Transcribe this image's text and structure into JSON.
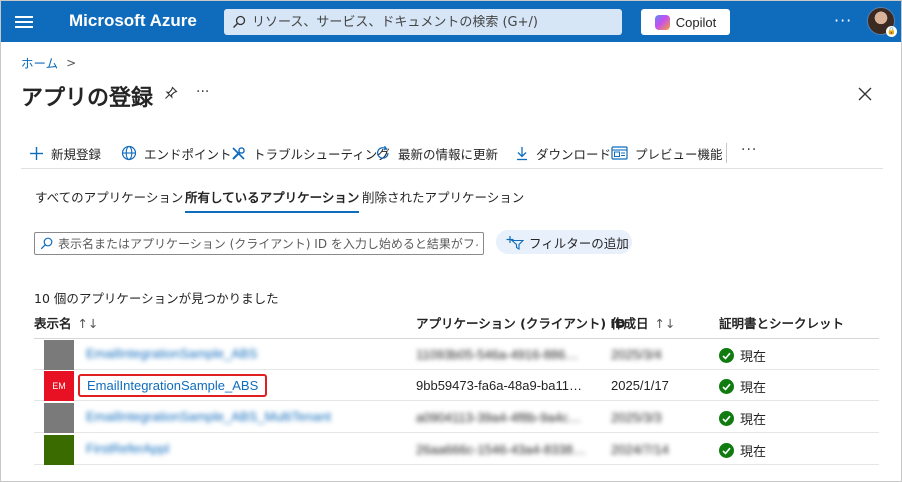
{
  "topbar": {
    "brand": "Microsoft Azure",
    "search_placeholder": "リソース、サービス、ドキュメントの検索 (G+/)",
    "copilot_label": "Copilot",
    "more_label": "···"
  },
  "breadcrumb": {
    "home": "ホーム",
    "separator": ">"
  },
  "page": {
    "title": "アプリの登録",
    "more_label": "···"
  },
  "toolbar": {
    "new_registration": "新規登録",
    "endpoints": "エンドポイント",
    "troubleshooting": "トラブルシューティング",
    "refresh": "最新の情報に更新",
    "download": "ダウンロード",
    "preview": "プレビュー機能",
    "more_label": "···"
  },
  "tabs": [
    {
      "label": "すべてのアプリケーション",
      "active": false
    },
    {
      "label": "所有しているアプリケーション",
      "active": true
    },
    {
      "label": "削除されたアプリケーション",
      "active": false
    }
  ],
  "filter": {
    "placeholder": "表示名またはアプリケーション (クライアント) ID を入力し始めると結果がフィ…",
    "add_filter_label": "フィルターの追加"
  },
  "results": {
    "count_text": "10 個のアプリケーションが見つかりました",
    "columns": {
      "name": "表示名",
      "name_sort": "↑↓",
      "app_id": "アプリケーション (クライアント) ID",
      "created": "作成日",
      "created_sort": "↑↓",
      "certs": "証明書とシークレット"
    },
    "rows": [
      {
        "tile_label": "",
        "tile_color": "#7a7a7a",
        "name": "EmailIntegrationSample_ABS",
        "app_id": "11093b05-546a-4916-886…",
        "created": "2025/3/4",
        "status": "現在",
        "blurred": true
      },
      {
        "tile_label": "EM",
        "tile_color": "#e81123",
        "name": "EmailIntegrationSample_ABS",
        "app_id": "9bb59473-fa6a-48a9-ba11…",
        "created": "2025/1/17",
        "status": "現在",
        "blurred": false
      },
      {
        "tile_label": "",
        "tile_color": "#7a7a7a",
        "name": "EmailIntegrationSample_ABS_MultiTenant",
        "app_id": "a0904113-39a4-4f8b-9a4c…",
        "created": "2025/3/3",
        "status": "現在",
        "blurred": true
      },
      {
        "tile_label": "",
        "tile_color": "#3a6b00",
        "name": "FirstReferAppl",
        "app_id": "26aa666c-1546-43a4-8338…",
        "created": "2024/7/14",
        "status": "現在",
        "blurred": true
      }
    ]
  },
  "colors": {
    "accent": "#0f6cbd",
    "highlight_border": "#e02020",
    "success": "#107c10"
  }
}
